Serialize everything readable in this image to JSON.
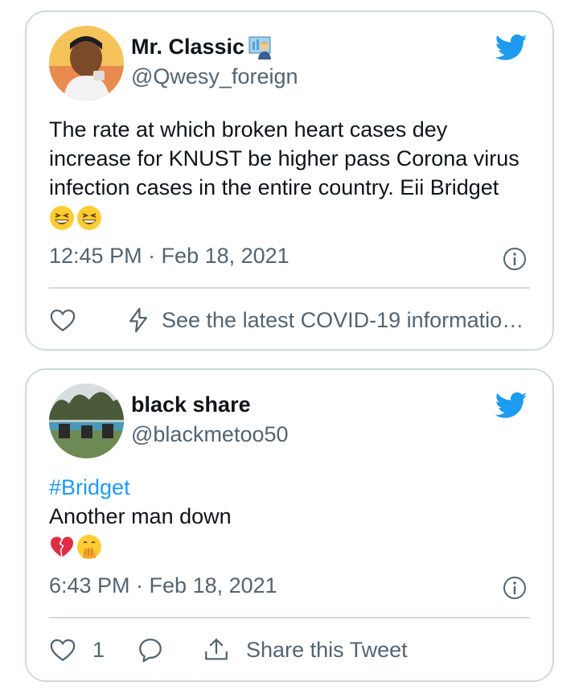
{
  "tweets": [
    {
      "display_name": "Mr. Classic",
      "handle": "@Qwesy_foreign",
      "text": "The rate at which broken heart cases dey increase for KNUST be higher pass Corona virus infection cases in the entire country. Eii Bridget",
      "emojis": [
        "grinning-squinting-face",
        "grinning-squinting-face"
      ],
      "timestamp": "12:45 PM · Feb 18, 2021",
      "covid_link": "See the latest COVID-19 informatio…",
      "icons": [
        "twitter-bird-icon",
        "info-icon",
        "heart-icon",
        "lightning-icon"
      ]
    },
    {
      "display_name": "black share",
      "handle": "@blackmetoo50",
      "hashtag": "#Bridget",
      "text": "Another man down",
      "emojis": [
        "broken-heart",
        "face-with-hand-over-mouth"
      ],
      "timestamp": "6:43 PM · Feb 18, 2021",
      "like_count": "1",
      "share_label": "Share this Tweet",
      "icons": [
        "twitter-bird-icon",
        "info-icon",
        "heart-icon",
        "reply-icon",
        "share-icon"
      ]
    }
  ],
  "colors": {
    "twitter_blue": "#1d9bf0",
    "text_primary": "#0f1419",
    "text_secondary": "#536471",
    "border": "#cfd9de"
  }
}
